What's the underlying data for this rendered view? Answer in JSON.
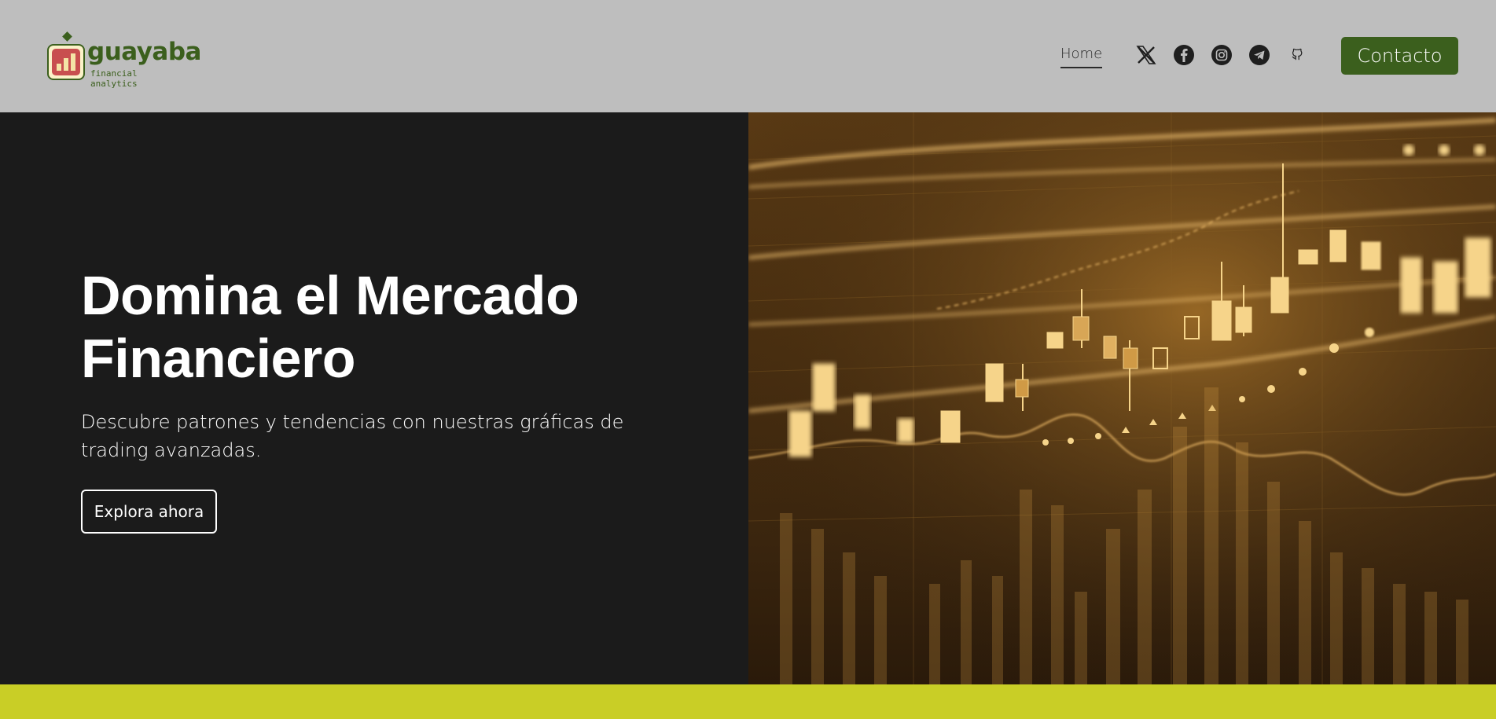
{
  "brand": {
    "name": "guayaba",
    "tagline": "financial analytics",
    "primary_color": "#3b5f1d",
    "logo_bg": "#fbf2c8",
    "logo_accent": "#c84f4f"
  },
  "header": {
    "background": "#bebebe",
    "nav": {
      "home_label": "Home"
    },
    "social_icons": [
      "x-icon",
      "facebook-icon",
      "instagram-icon",
      "telegram-icon",
      "github-icon"
    ],
    "contact_label": "Contacto"
  },
  "hero": {
    "title": "Domina el Mercado Financiero",
    "subtitle": "Descubre patrones y tendencias con nuestras gráficas de trading avanzadas.",
    "cta_label": "Explora ahora",
    "image_description": "trading-candlestick-chart-photo",
    "image_tone": "#c98a2e"
  },
  "footer_band": {
    "color": "#c9ce26"
  }
}
